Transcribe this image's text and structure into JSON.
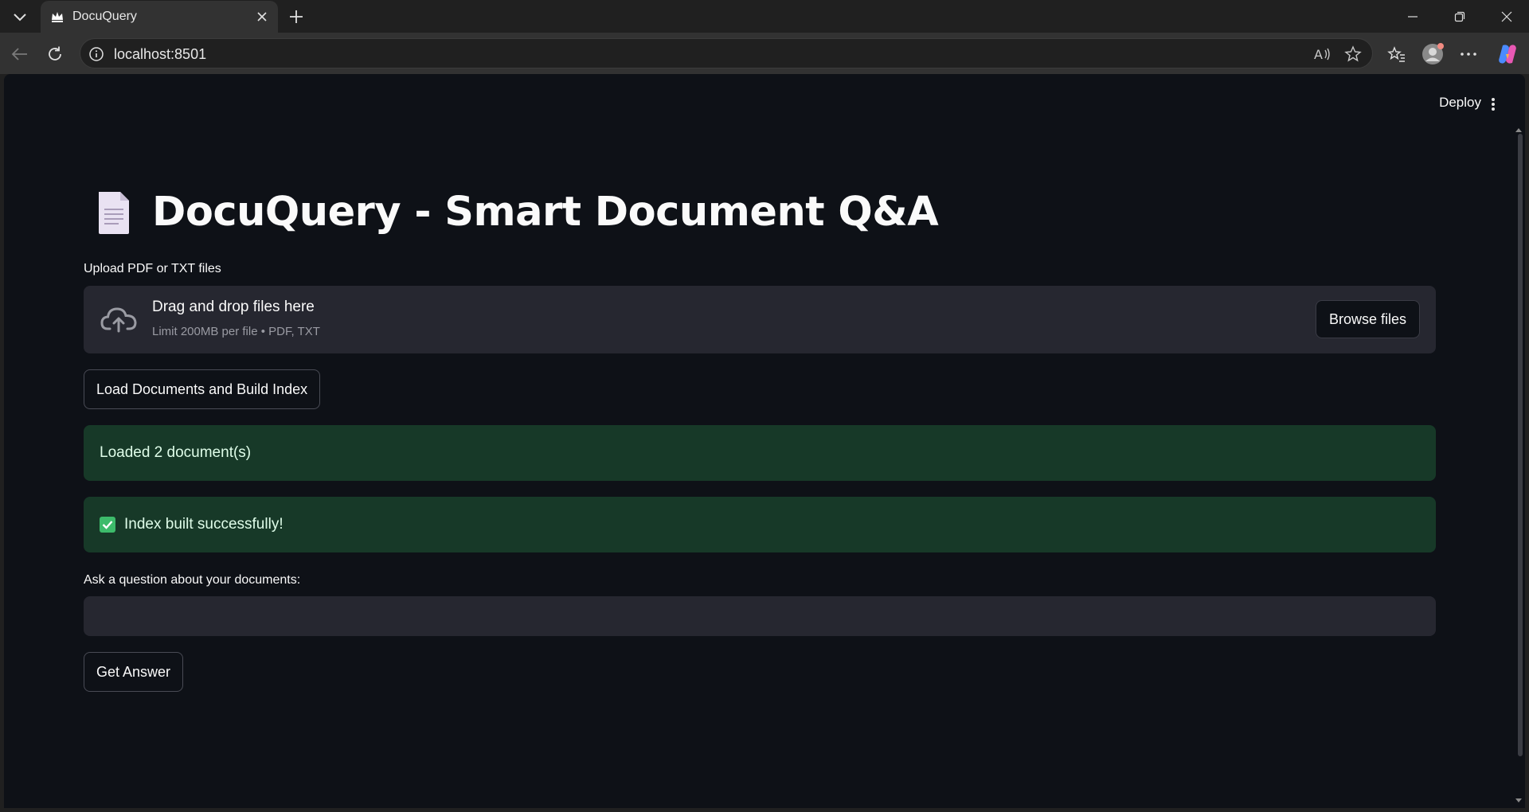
{
  "browser": {
    "tab_title": "DocuQuery",
    "url": "localhost:8501"
  },
  "app": {
    "deploy_label": "Deploy",
    "title_emoji": "page-facing-up-emoji",
    "title": "DocuQuery - Smart Document Q&A",
    "uploader": {
      "label": "Upload PDF or TXT files",
      "drop_title": "Drag and drop files here",
      "drop_subtitle": "Limit 200MB per file • PDF, TXT",
      "browse_label": "Browse files"
    },
    "load_button_label": "Load Documents and Build Index",
    "alerts": {
      "loaded": "Loaded 2 document(s)",
      "index_built": "Index built successfully!"
    },
    "question": {
      "label": "Ask a question about your documents:",
      "value": "",
      "placeholder": ""
    },
    "answer_button_label": "Get Answer"
  },
  "colors": {
    "app_background": "#0e1117",
    "widget_background": "#262730",
    "success_background": "#173928",
    "success_text": "#dffde9",
    "success_check": "#3dbb6b"
  }
}
